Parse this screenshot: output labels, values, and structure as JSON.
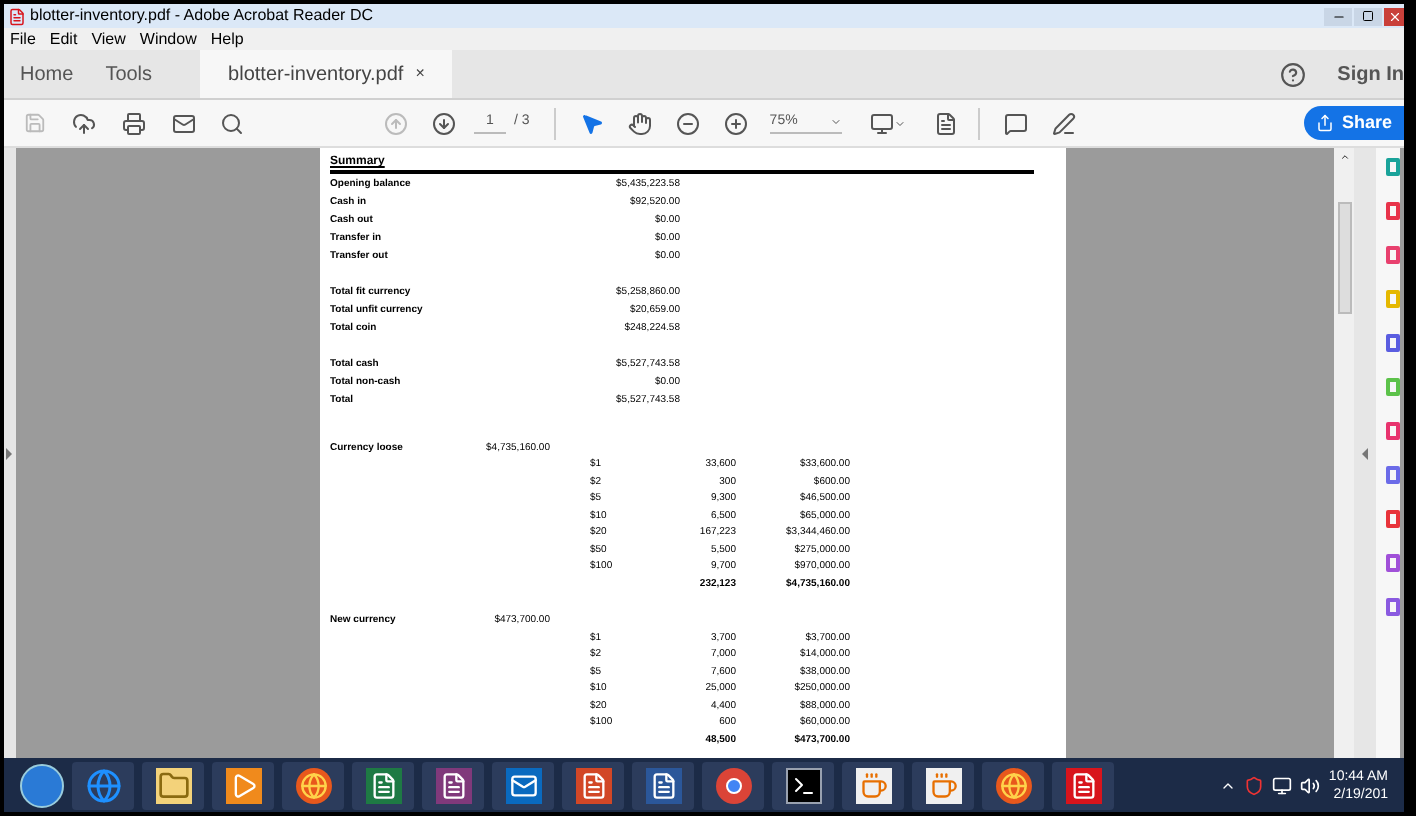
{
  "window": {
    "title": "blotter-inventory.pdf - Adobe Acrobat Reader DC"
  },
  "menu": [
    "File",
    "Edit",
    "View",
    "Window",
    "Help"
  ],
  "tabs": [
    {
      "label": "Home",
      "selected": false
    },
    {
      "label": "Tools",
      "selected": false
    },
    {
      "label": "blotter-inventory.pdf",
      "selected": true,
      "close": "×"
    }
  ],
  "sign_in": "Sign In",
  "toolbar": {
    "page": "1",
    "page_count": "/ 3",
    "zoom": "75%",
    "share": "Share"
  },
  "document": {
    "heading": "Summary",
    "summary": [
      [
        {
          "label": "Opening balance",
          "amount": "$5,435,223.58"
        },
        {
          "label": "Cash in",
          "amount": "$92,520.00"
        },
        {
          "label": "Cash out",
          "amount": "$0.00"
        },
        {
          "label": "Transfer in",
          "amount": "$0.00"
        },
        {
          "label": "Transfer out",
          "amount": "$0.00"
        }
      ],
      [
        {
          "label": "Total fit currency",
          "amount": "$5,258,860.00"
        },
        {
          "label": "Total unfit currency",
          "amount": "$20,659.00"
        },
        {
          "label": "Total coin",
          "amount": "$248,224.58"
        }
      ],
      [
        {
          "label": "Total cash",
          "amount": "$5,527,743.58"
        },
        {
          "label": "Total non-cash",
          "amount": "$0.00"
        },
        {
          "label": "Total",
          "amount": "$5,527,743.58"
        }
      ]
    ],
    "sections": [
      {
        "label": "Currency loose",
        "amount": "$4,735,160.00",
        "rows": [
          {
            "denomination": "$1",
            "count": "33,600",
            "value": "$33,600.00"
          },
          {
            "denomination": "$2",
            "count": "300",
            "value": "$600.00"
          },
          {
            "denomination": "$5",
            "count": "9,300",
            "value": "$46,500.00"
          },
          {
            "denomination": "$10",
            "count": "6,500",
            "value": "$65,000.00"
          },
          {
            "denomination": "$20",
            "count": "167,223",
            "value": "$3,344,460.00"
          },
          {
            "denomination": "$50",
            "count": "5,500",
            "value": "$275,000.00"
          },
          {
            "denomination": "$100",
            "count": "9,700",
            "value": "$970,000.00"
          }
        ],
        "total_count": "232,123",
        "total_value": "$4,735,160.00"
      },
      {
        "label": "New currency",
        "amount": "$473,700.00",
        "rows": [
          {
            "denomination": "$1",
            "count": "3,700",
            "value": "$3,700.00"
          },
          {
            "denomination": "$2",
            "count": "7,000",
            "value": "$14,000.00"
          },
          {
            "denomination": "$5",
            "count": "7,600",
            "value": "$38,000.00"
          },
          {
            "denomination": "$10",
            "count": "25,000",
            "value": "$250,000.00"
          },
          {
            "denomination": "$20",
            "count": "4,400",
            "value": "$88,000.00"
          },
          {
            "denomination": "$100",
            "count": "600",
            "value": "$60,000.00"
          }
        ],
        "total_count": "48,500",
        "total_value": "$473,700.00"
      }
    ]
  },
  "tool_pane": [
    {
      "color": "#1aa39a"
    },
    {
      "color": "#e8334a"
    },
    {
      "color": "#e8406e"
    },
    {
      "color": "#e5b800"
    },
    {
      "color": "#5a5de0"
    },
    {
      "color": "#5cc24a"
    },
    {
      "color": "#e8336e"
    },
    {
      "color": "#6b6be8"
    },
    {
      "color": "#e8333a"
    },
    {
      "color": "#a050d8"
    },
    {
      "color": "#8a5ae0"
    }
  ],
  "taskbar": {
    "apps": [
      {
        "kind": "ie"
      },
      {
        "kind": "folder"
      },
      {
        "kind": "media"
      },
      {
        "kind": "firefox"
      },
      {
        "kind": "excel"
      },
      {
        "kind": "onenote"
      },
      {
        "kind": "outlook"
      },
      {
        "kind": "powerpoint"
      },
      {
        "kind": "word"
      },
      {
        "kind": "chrome"
      },
      {
        "kind": "console"
      },
      {
        "kind": "java"
      },
      {
        "kind": "java"
      },
      {
        "kind": "firefox"
      },
      {
        "kind": "acrobat"
      }
    ],
    "time": "10:44 AM",
    "date": "2/19/201"
  }
}
